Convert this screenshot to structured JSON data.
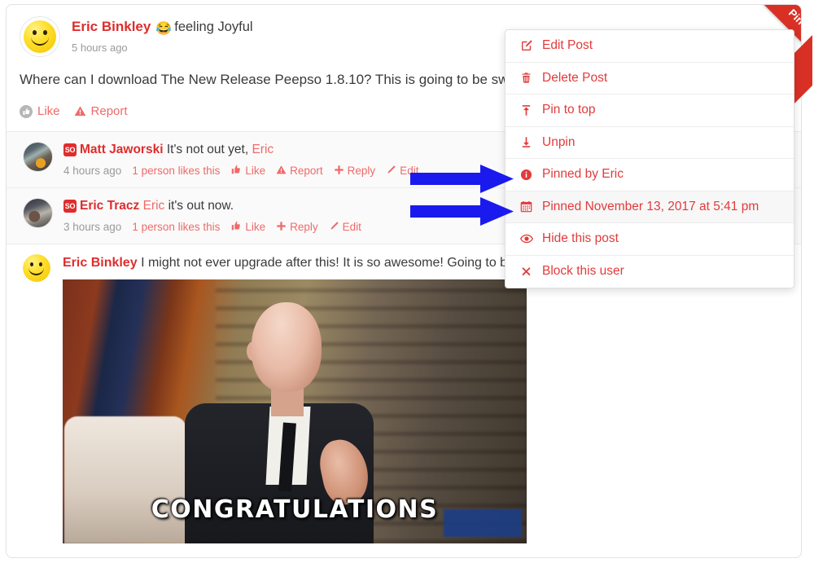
{
  "post": {
    "author": "Eric Binkley",
    "emoji": "😂",
    "feeling": "feeling Joyful",
    "time": "5 hours ago",
    "body": "Where can I download The New Release Peepso 1.8.10? This is going to be sweet!",
    "actions": [
      {
        "label": "Like",
        "icon": "thumbs-up-icon"
      },
      {
        "label": "Report",
        "icon": "warning-triangle-icon"
      }
    ]
  },
  "ribbon": {
    "label": "Pin",
    "color": "#d93025"
  },
  "comments": [
    {
      "badge": "SO",
      "name": "Matt Jaworski",
      "text": "It's not out yet, ",
      "mention": "Eric",
      "time": "4 hours ago",
      "likes": "1 person likes this",
      "actions": [
        {
          "label": "Like",
          "icon": "thumbs-up-icon"
        },
        {
          "label": "Report",
          "icon": "warning-triangle-icon"
        },
        {
          "label": "Reply",
          "icon": "plus-icon"
        },
        {
          "label": "Edit",
          "icon": "pencil-icon"
        }
      ]
    },
    {
      "badge": "SO",
      "name": "Eric Tracz",
      "mention": "Eric",
      "text": " it's out now.",
      "time": "3 hours ago",
      "likes": "1 person likes this",
      "actions": [
        {
          "label": "Like",
          "icon": "thumbs-up-icon"
        },
        {
          "label": "Reply",
          "icon": "plus-icon"
        },
        {
          "label": "Edit",
          "icon": "pencil-icon"
        }
      ]
    }
  ],
  "sub_post": {
    "author": "Eric Binkley",
    "text": "I might not ever upgrade after this! It is so awesome! Going to be ha",
    "gif_caption": "CONGRATULATIONS"
  },
  "dropdown": {
    "items": [
      {
        "label": "Edit Post",
        "icon": "edit-square-icon",
        "highlighted": false
      },
      {
        "label": "Delete Post",
        "icon": "trash-icon",
        "highlighted": false
      },
      {
        "label": "Pin to top",
        "icon": "pin-up-icon",
        "highlighted": false
      },
      {
        "label": "Unpin",
        "icon": "pin-down-icon",
        "highlighted": false
      },
      {
        "label": "Pinned by Eric",
        "icon": "info-circle-icon",
        "highlighted": false
      },
      {
        "label": "Pinned November 13, 2017 at 5:41 pm",
        "icon": "calendar-icon",
        "highlighted": true
      },
      {
        "label": "Hide this post",
        "icon": "eye-icon",
        "highlighted": false
      },
      {
        "label": "Block this user",
        "icon": "x-mark-icon",
        "highlighted": false
      }
    ],
    "accent_color": "#e23b3b"
  },
  "annotations": {
    "arrow_color": "#1a1aee",
    "arrows": [
      {
        "target": "Pinned by Eric"
      },
      {
        "target": "Pinned November 13, 2017 at 5:41 pm"
      }
    ]
  }
}
